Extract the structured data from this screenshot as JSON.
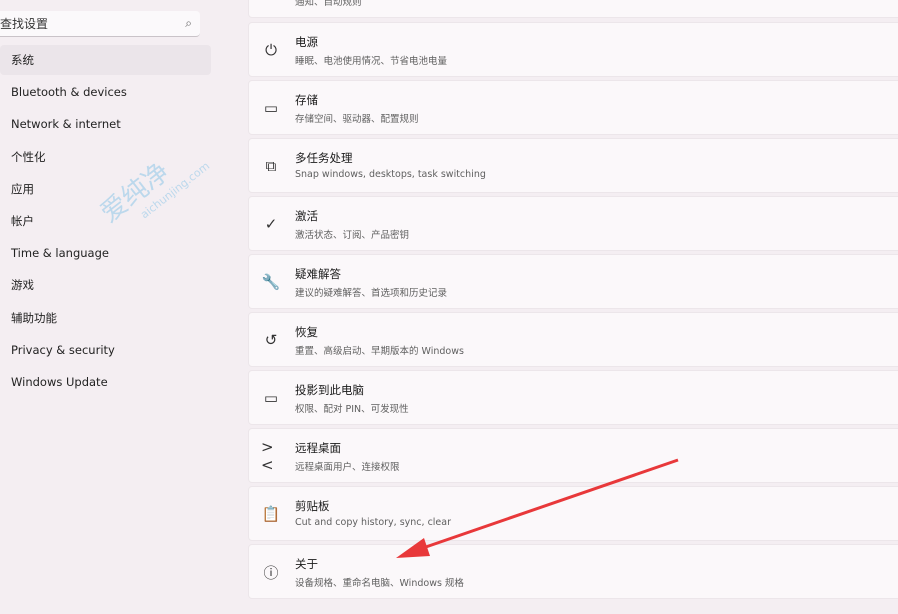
{
  "search": {
    "placeholder": "查找设置"
  },
  "sidebar": {
    "items": [
      {
        "label": "系统",
        "selected": true
      },
      {
        "label": "Bluetooth & devices"
      },
      {
        "label": "Network & internet"
      },
      {
        "label": "个性化"
      },
      {
        "label": "应用"
      },
      {
        "label": "帐户"
      },
      {
        "label": "Time & language"
      },
      {
        "label": "游戏"
      },
      {
        "label": "辅助功能"
      },
      {
        "label": "Privacy & security"
      },
      {
        "label": "Windows Update"
      }
    ]
  },
  "cards": [
    {
      "title": "",
      "subtitle": "通知、自动规则",
      "icon": "bell-icon"
    },
    {
      "title": "电源",
      "subtitle": "睡眠、电池使用情况、节省电池电量",
      "icon": "power-icon"
    },
    {
      "title": "存储",
      "subtitle": "存储空间、驱动器、配置规则",
      "icon": "storage-icon"
    },
    {
      "title": "多任务处理",
      "subtitle": "Snap windows, desktops, task switching",
      "icon": "multitask-icon"
    },
    {
      "title": "激活",
      "subtitle": "激活状态、订阅、产品密钥",
      "icon": "check-circle-icon"
    },
    {
      "title": "疑难解答",
      "subtitle": "建议的疑难解答、首选项和历史记录",
      "icon": "wrench-icon"
    },
    {
      "title": "恢复",
      "subtitle": "重置、高级启动、早期版本的 Windows",
      "icon": "recovery-icon"
    },
    {
      "title": "投影到此电脑",
      "subtitle": "权限、配对 PIN、可发现性",
      "icon": "project-icon"
    },
    {
      "title": "远程桌面",
      "subtitle": "远程桌面用户、连接权限",
      "icon": "remote-desktop-icon"
    },
    {
      "title": "剪贴板",
      "subtitle": "Cut and copy history, sync, clear",
      "icon": "clipboard-icon"
    },
    {
      "title": "关于",
      "subtitle": "设备规格、重命名电脑、Windows 规格",
      "icon": "info-icon"
    }
  ],
  "watermark": {
    "text": "爱纯净",
    "url": "aichunjing.com"
  },
  "colors": {
    "arrow": "#e8383a",
    "background": "#f4eef2",
    "card": "#fbf8fa"
  }
}
